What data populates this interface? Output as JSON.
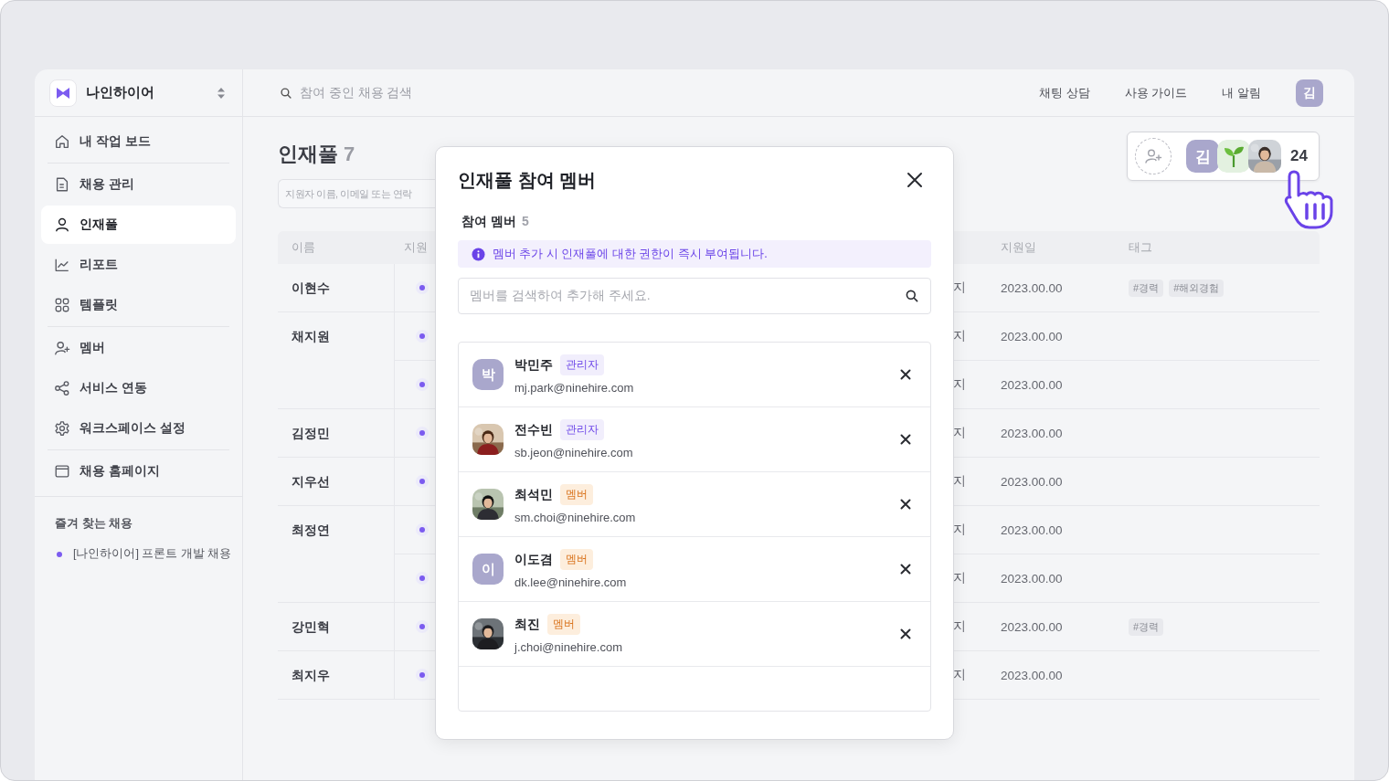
{
  "sidebar": {
    "workspace": "나인하이어",
    "nav_groups": [
      [
        {
          "label": "내 작업 보드",
          "kind": "home",
          "selected": false
        }
      ],
      [
        {
          "label": "채용 관리",
          "kind": "doc",
          "selected": false
        },
        {
          "label": "인재풀",
          "kind": "user",
          "selected": true
        },
        {
          "label": "리포트",
          "kind": "chart",
          "selected": false
        },
        {
          "label": "템플릿",
          "kind": "grid",
          "selected": false
        }
      ],
      [
        {
          "label": "멤버",
          "kind": "user-plus",
          "selected": false
        },
        {
          "label": "서비스 연동",
          "kind": "share",
          "selected": false
        },
        {
          "label": "워크스페이스 설정",
          "kind": "gear",
          "selected": false
        }
      ],
      [
        {
          "label": "채용 홈페이지",
          "kind": "window",
          "selected": false
        }
      ]
    ],
    "favorites": {
      "title": "즐겨 찾는 채용",
      "items": [
        "[나인하이어] 프론트 개발 채용"
      ]
    }
  },
  "topbar": {
    "search_placeholder": "참여 중인 채용 검색",
    "links": [
      "채팅 상담",
      "사용 가이드",
      "내 알림"
    ],
    "avatar": "김"
  },
  "page": {
    "title": "인재풀",
    "count": "7",
    "search_placeholder": "지원자 이름, 이메일 또는 연락"
  },
  "participants": {
    "avatars": [
      {
        "kind": "add"
      },
      {
        "kind": "initial",
        "text": "김"
      },
      {
        "kind": "sprout"
      },
      {
        "kind": "picture"
      }
    ],
    "count": "24"
  },
  "table": {
    "columns": [
      "이름",
      "지원",
      "지원일",
      "태그"
    ],
    "rows": [
      {
        "name": "이현수",
        "applications": [
          {
            "status": "지",
            "date": "2023.00.00",
            "tags": [
              "#경력",
              "#해외경험"
            ]
          }
        ]
      },
      {
        "name": "채지원",
        "applications": [
          {
            "status": "지",
            "date": "2023.00.00"
          },
          {
            "status": "지",
            "date": "2023.00.00"
          }
        ]
      },
      {
        "name": "김정민",
        "applications": [
          {
            "status": "지",
            "date": "2023.00.00"
          }
        ]
      },
      {
        "name": "지우선",
        "applications": [
          {
            "status": "지",
            "date": "2023.00.00"
          }
        ]
      },
      {
        "name": "최정연",
        "applications": [
          {
            "status": "지",
            "date": "2023.00.00"
          },
          {
            "status": "지",
            "date": "2023.00.00"
          }
        ]
      },
      {
        "name": "강민혁",
        "applications": [
          {
            "status": "지",
            "date": "2023.00.00",
            "tags": [
              "#경력"
            ]
          }
        ]
      },
      {
        "name": "최지우",
        "applications": [
          {
            "status": "지",
            "date": "2023.00.00"
          }
        ]
      }
    ]
  },
  "modal": {
    "title": "인재풀 참여 멤버",
    "section_label": "참여 멤버",
    "section_count": "5",
    "notice": "멤버 추가 시 인재풀에 대한 권한이 즉시 부여됩니다.",
    "search_placeholder": "멤버를 검색하여 추가해 주세요.",
    "members": [
      {
        "name": "박민주",
        "role": {
          "label": "관리자",
          "kind": "admin"
        },
        "email": "mj.park@ninehire.com",
        "avatar": {
          "kind": "initial",
          "text": "박"
        }
      },
      {
        "name": "전수빈",
        "role": {
          "label": "관리자",
          "kind": "admin"
        },
        "email": "sb.jeon@ninehire.com",
        "avatar": {
          "kind": "picture"
        }
      },
      {
        "name": "최석민",
        "role": {
          "label": "멤버",
          "kind": "member"
        },
        "email": "sm.choi@ninehire.com",
        "avatar": {
          "kind": "picture"
        }
      },
      {
        "name": "이도겸",
        "role": {
          "label": "멤버",
          "kind": "member"
        },
        "email": "dk.lee@ninehire.com",
        "avatar": {
          "kind": "initial",
          "text": "이"
        }
      },
      {
        "name": "최진",
        "role": {
          "label": "멤버",
          "kind": "member"
        },
        "email": "j.choi@ninehire.com",
        "avatar": {
          "kind": "picture"
        }
      }
    ]
  }
}
